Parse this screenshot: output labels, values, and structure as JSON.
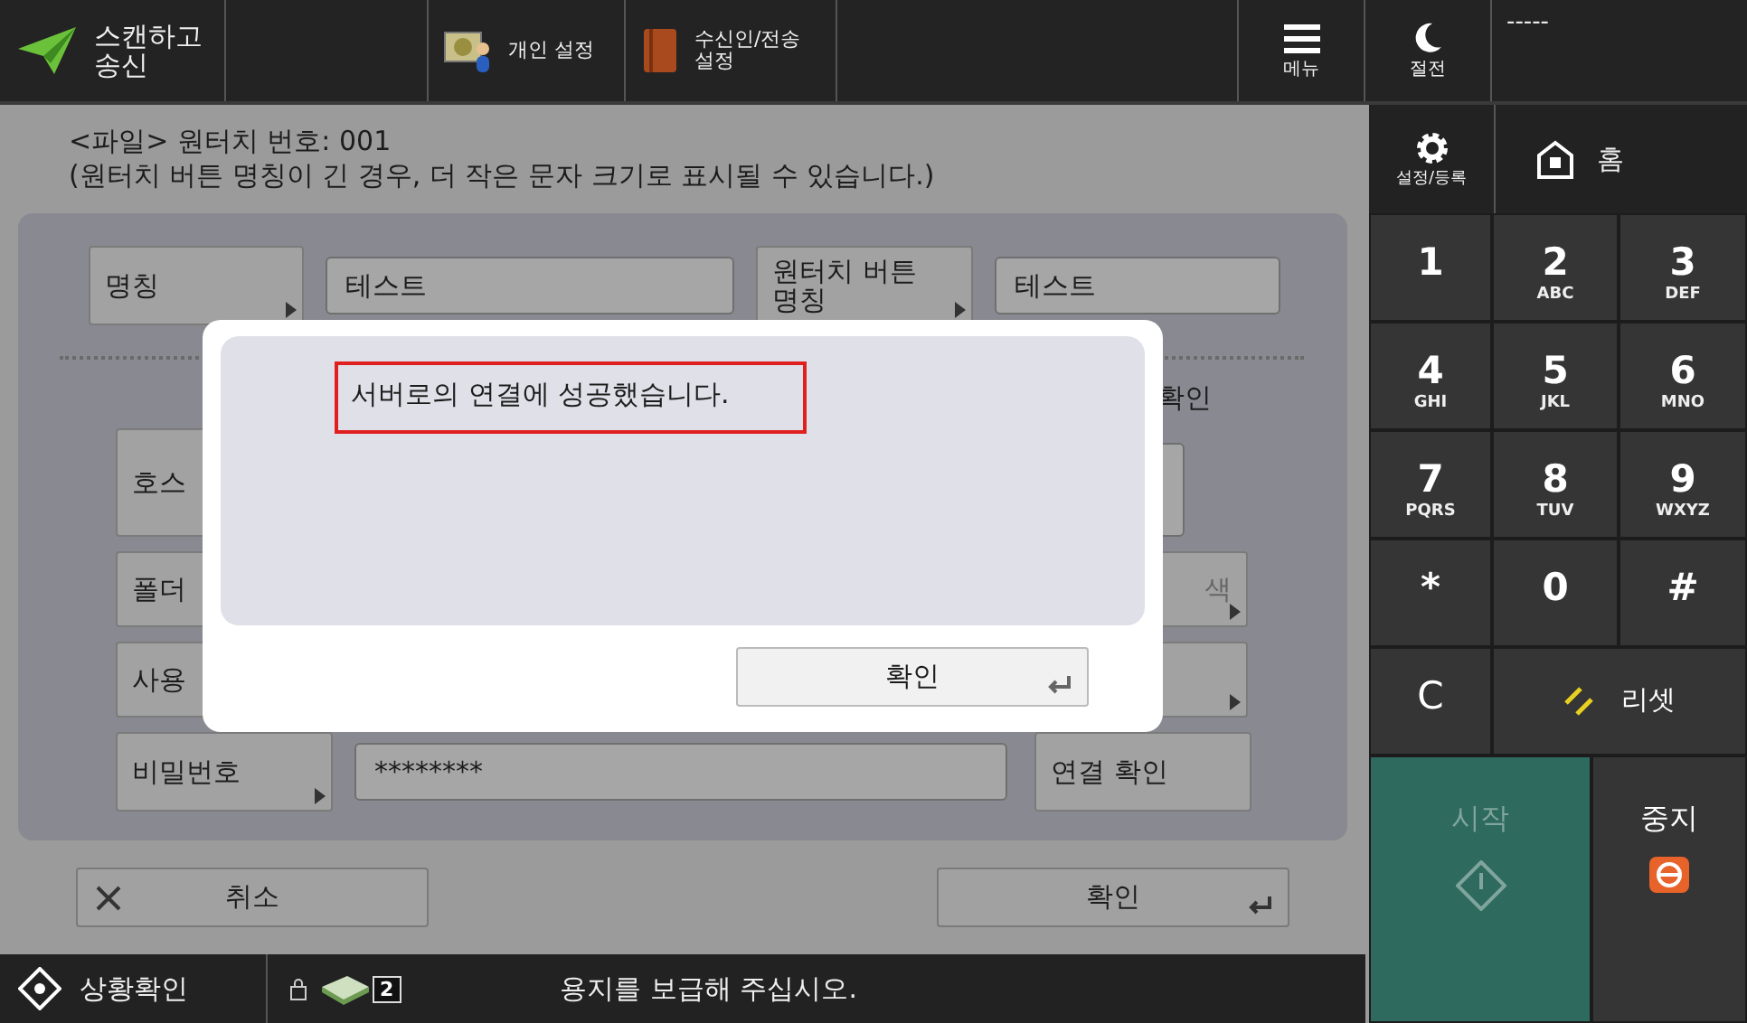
{
  "header": {
    "app_title": "스캔하고\n송신",
    "tools": [
      {
        "label": "개인 설정",
        "kind": "personal"
      },
      {
        "label": "수신인/전송\n설정",
        "kind": "book"
      }
    ],
    "menu": "메뉴",
    "sleep": "절전",
    "user": "-----"
  },
  "side": {
    "settings": "설정/등록",
    "home": "홈",
    "keys": [
      {
        "main": "1"
      },
      {
        "main": "2",
        "sub": "ABC"
      },
      {
        "main": "3",
        "sub": "DEF"
      },
      {
        "main": "4",
        "sub": "GHI"
      },
      {
        "main": "5",
        "sub": "JKL"
      },
      {
        "main": "6",
        "sub": "MNO"
      },
      {
        "main": "7",
        "sub": "PQRS"
      },
      {
        "main": "8",
        "sub": "TUV"
      },
      {
        "main": "9",
        "sub": "WXYZ"
      },
      {
        "main": "*"
      },
      {
        "main": "0"
      },
      {
        "main": "#"
      }
    ],
    "clear": "C",
    "reset": "리셋",
    "start": {
      "label": "시작",
      "disabled": true
    },
    "stop": "중지"
  },
  "form": {
    "heading": "<파일> 원터치 번호: 001",
    "note": "(원터치 버튼 명칭이 긴 경우, 더 작은 문자 크기로 표시될 수 있습니다.)",
    "name_button": "명칭",
    "name_value": "테스트",
    "onetouch_button": "원터치 버튼\n명칭",
    "onetouch_value": "테스트",
    "check_fragment": "확인",
    "rows": [
      {
        "label": "호스",
        "kind": "field"
      },
      {
        "label": "폴더",
        "kind": "button",
        "side_button": "색",
        "side_disabled": true
      },
      {
        "label": "사용",
        "kind": "button"
      }
    ],
    "password": {
      "label": "비밀번호",
      "value": "********",
      "side": "연결 확인"
    }
  },
  "footer": {
    "cancel": "취소",
    "ok": "확인"
  },
  "dialog": {
    "message": "서버로의 연결에 성공했습니다.",
    "button": "확인"
  },
  "status": {
    "label": "상황확인",
    "count": "2",
    "message": "용지를 보급해 주십시오."
  }
}
